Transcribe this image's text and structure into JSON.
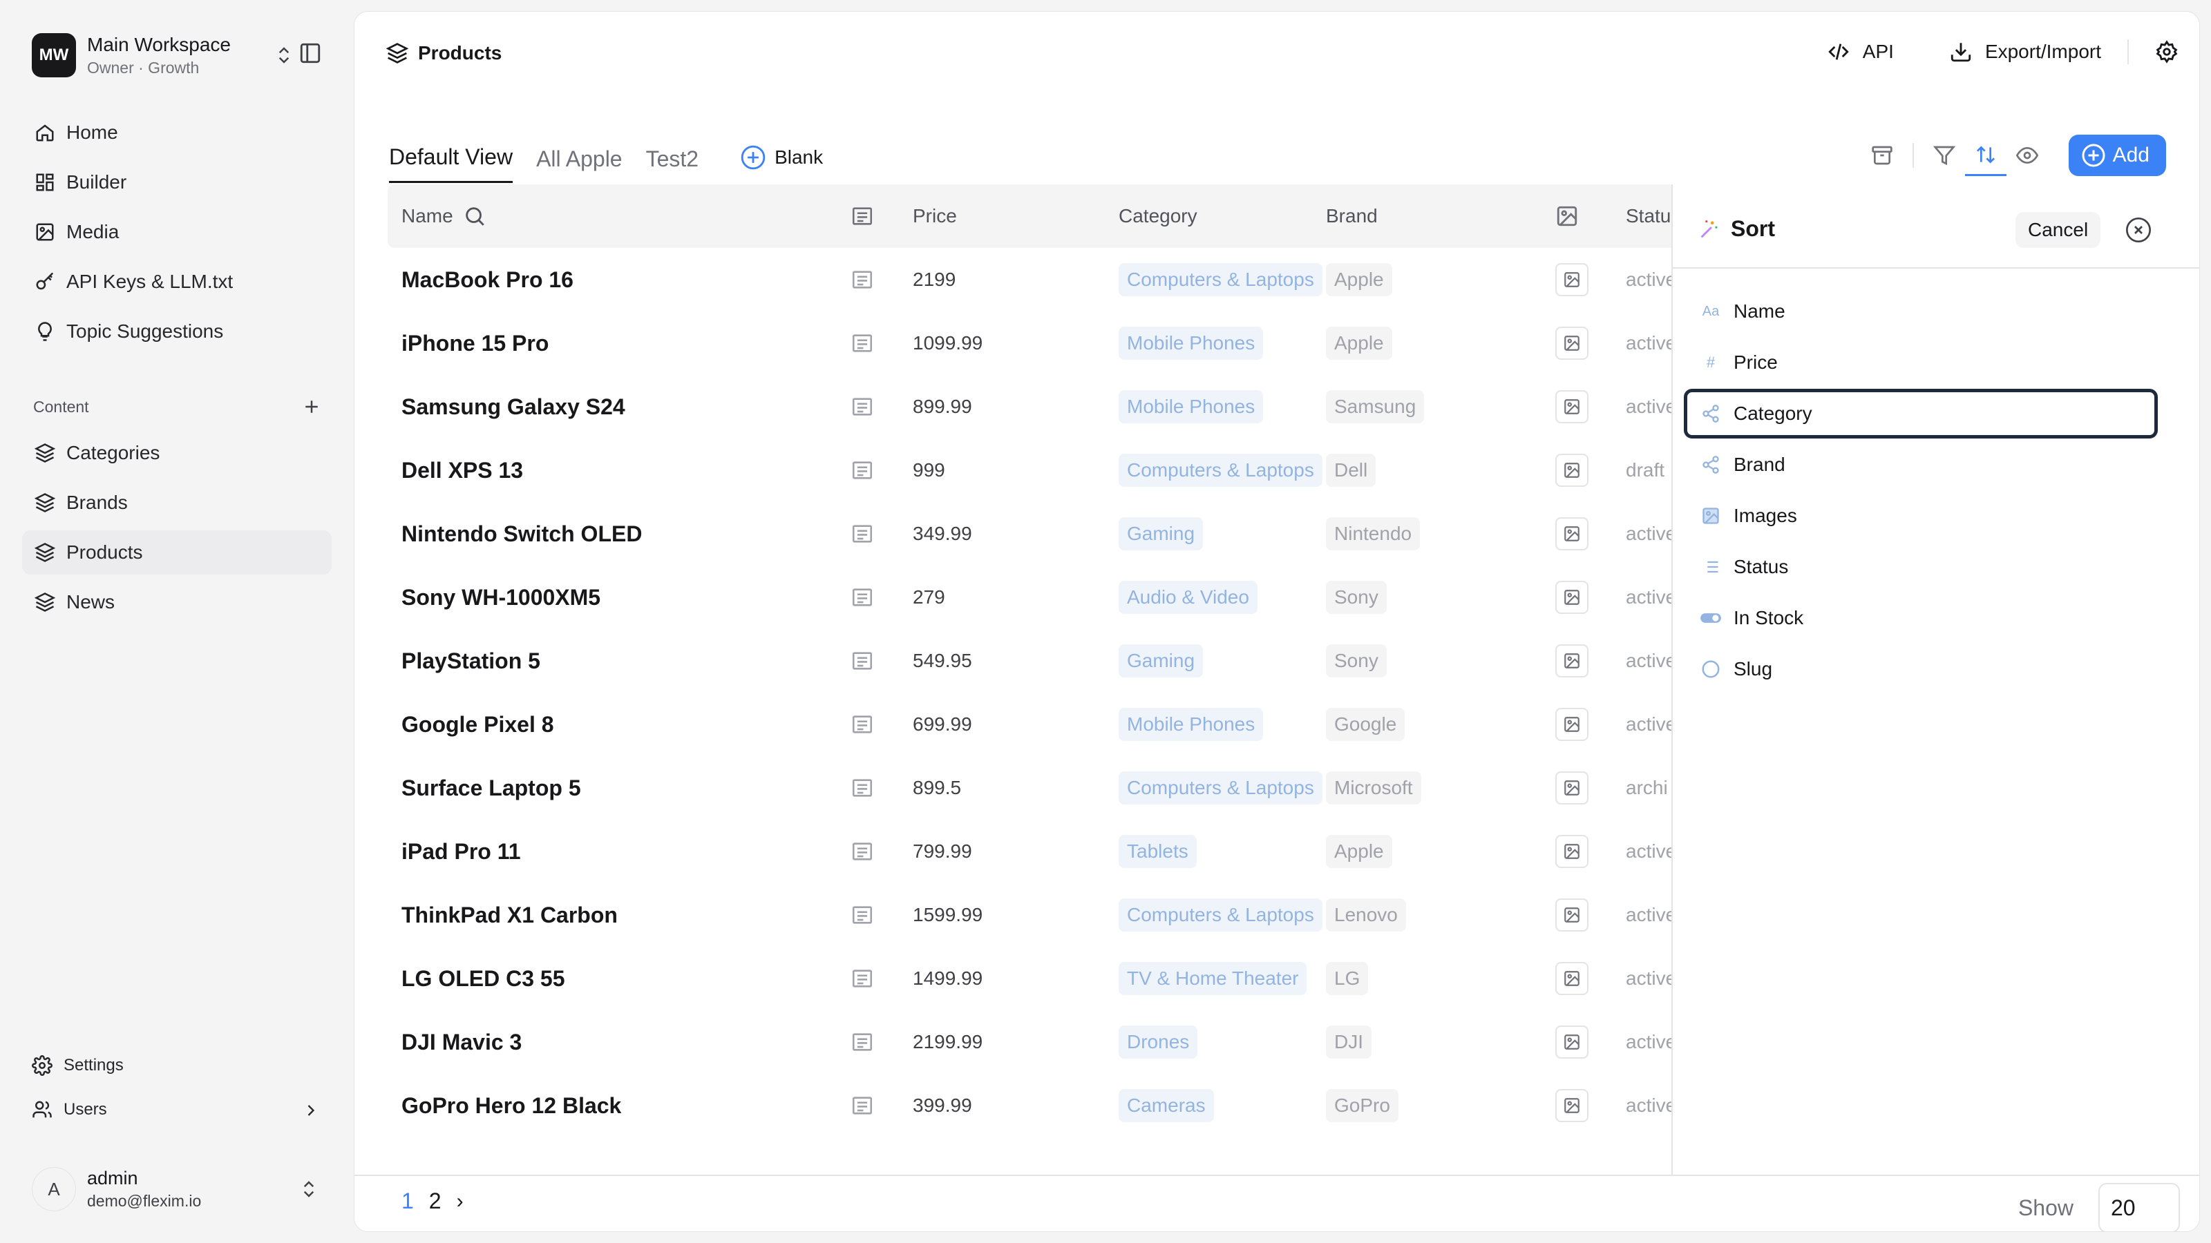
{
  "workspace": {
    "initials": "MW",
    "name": "Main Workspace",
    "subtitle": "Owner · Growth"
  },
  "nav": {
    "home": "Home",
    "builder": "Builder",
    "media": "Media",
    "api_keys": "API Keys & LLM.txt",
    "topics": "Topic Suggestions",
    "content_label": "Content",
    "categories": "Categories",
    "brands": "Brands",
    "products": "Products",
    "news": "News",
    "settings": "Settings",
    "users": "Users"
  },
  "user": {
    "initial": "A",
    "name": "admin",
    "email": "demo@flexim.io"
  },
  "header": {
    "title": "Products",
    "api_label": "API",
    "export_label": "Export/Import"
  },
  "tabs": {
    "default": "Default View",
    "all_apple": "All Apple",
    "test2": "Test2",
    "blank": "Blank"
  },
  "toolbar": {
    "add_label": "Add"
  },
  "columns": {
    "name": "Name",
    "price": "Price",
    "category": "Category",
    "brand": "Brand",
    "status": "Status"
  },
  "rows": [
    {
      "name": "MacBook Pro 16",
      "price": "2199",
      "category": "Computers & Laptops",
      "brand": "Apple",
      "status": "active"
    },
    {
      "name": "iPhone 15 Pro",
      "price": "1099.99",
      "category": "Mobile Phones",
      "brand": "Apple",
      "status": "active"
    },
    {
      "name": "Samsung Galaxy S24",
      "price": "899.99",
      "category": "Mobile Phones",
      "brand": "Samsung",
      "status": "active"
    },
    {
      "name": "Dell XPS 13",
      "price": "999",
      "category": "Computers & Laptops",
      "brand": "Dell",
      "status": "draft"
    },
    {
      "name": "Nintendo Switch OLED",
      "price": "349.99",
      "category": "Gaming",
      "brand": "Nintendo",
      "status": "active"
    },
    {
      "name": "Sony WH-1000XM5",
      "price": "279",
      "category": "Audio & Video",
      "brand": "Sony",
      "status": "active"
    },
    {
      "name": "PlayStation 5",
      "price": "549.95",
      "category": "Gaming",
      "brand": "Sony",
      "status": "active"
    },
    {
      "name": "Google Pixel 8",
      "price": "699.99",
      "category": "Mobile Phones",
      "brand": "Google",
      "status": "active"
    },
    {
      "name": "Surface Laptop 5",
      "price": "899.5",
      "category": "Computers & Laptops",
      "brand": "Microsoft",
      "status": "archi"
    },
    {
      "name": "iPad Pro 11",
      "price": "799.99",
      "category": "Tablets",
      "brand": "Apple",
      "status": "active"
    },
    {
      "name": "ThinkPad X1 Carbon",
      "price": "1599.99",
      "category": "Computers & Laptops",
      "brand": "Lenovo",
      "status": "active"
    },
    {
      "name": "LG OLED C3 55",
      "price": "1499.99",
      "category": "TV & Home Theater",
      "brand": "LG",
      "status": "active"
    },
    {
      "name": "DJI Mavic 3",
      "price": "2199.99",
      "category": "Drones",
      "brand": "DJI",
      "status": "active"
    },
    {
      "name": "GoPro Hero 12 Black",
      "price": "399.99",
      "category": "Cameras",
      "brand": "GoPro",
      "status": "active"
    }
  ],
  "sort_panel": {
    "title": "Sort",
    "cancel": "Cancel",
    "fields": [
      "Name",
      "Price",
      "Category",
      "Brand",
      "Images",
      "Status",
      "In Stock",
      "Slug"
    ],
    "focused_field": "Category",
    "name_icon_text": "Aa",
    "price_icon_text": "#"
  },
  "pagination": {
    "pages": [
      "1",
      "2"
    ],
    "current": "1",
    "next": "›"
  },
  "page_size": {
    "label": "Show",
    "value": "20"
  },
  "colors": {
    "accent": "#3b82f6",
    "chip_bg": "#eff4fb",
    "chip_text": "#93b4e0",
    "dark": "#18181b"
  }
}
